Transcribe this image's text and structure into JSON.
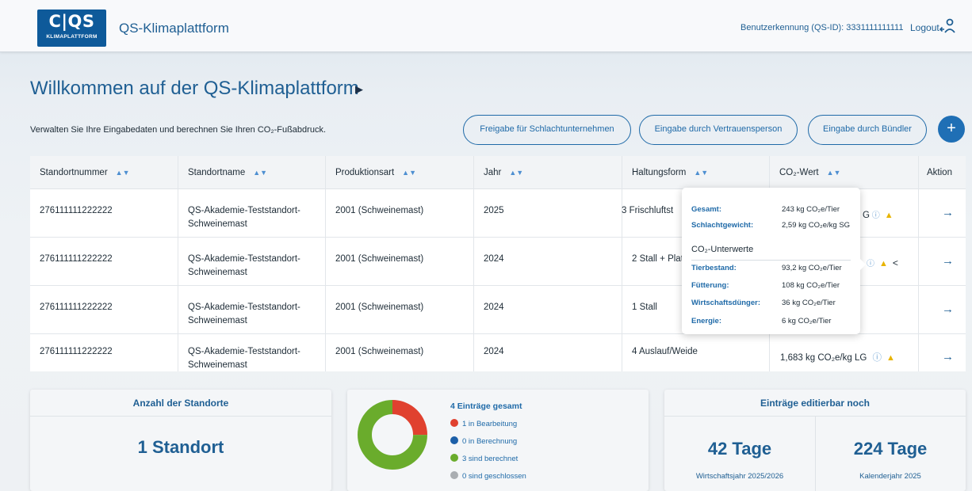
{
  "header": {
    "logo_mark": "C|QS",
    "logo_sub": "KLIMAPLATTFORM",
    "app_title": "QS-Klimaplattform",
    "user_id": "Benutzerkennung (QS-ID): 3331111111111",
    "logout": "Logout"
  },
  "page": {
    "title": "Willkommen auf der QS-Klimaplattform",
    "subline": "Verwalten Sie Ihre Eingabedaten und berechnen Sie Ihren CO₂-Fußabdruck.",
    "buttons": {
      "release": "Freigabe für Schlachtunternehmen",
      "trustee": "Eingabe durch Vertrauensperson",
      "bundler": "Eingabe durch Bündler"
    },
    "add_label": "+"
  },
  "table": {
    "headers": [
      "Standortnummer",
      "Standortname",
      "Produktionsart",
      "Jahr",
      "Haltungsform",
      "CO₂-Wert",
      "Aktion"
    ],
    "rows": [
      {
        "nr": "276111111222222",
        "name1": "QS-Akademie-Teststandort-",
        "name2": "Schweinemast",
        "art": "2001 (Schweinemast)",
        "jahr": "2025",
        "haltung": "3 Frischluftst",
        "co2": ""
      },
      {
        "nr": "276111111222222",
        "name1": "QS-Akademie-Teststandort-",
        "name2": "Schweinemast",
        "art": "2001 (Schweinemast)",
        "jahr": "2024",
        "haltung": "2 Stall + Platz",
        "co2": ""
      },
      {
        "nr": "276111111222222",
        "name1": "QS-Akademie-Teststandort-",
        "name2": "Schweinemast",
        "art": "2001 (Schweinemast)",
        "jahr": "2024",
        "haltung": "1 Stall",
        "co2": ""
      },
      {
        "nr": "276111111222222",
        "name1": "QS-Akademie-Teststandort-",
        "name2": "Schweinemast",
        "art": "2001 (Schweinemast)",
        "jahr": "2024",
        "haltung": "4 Auslauf/Weide",
        "co2": "1,683 kg CO₂e/kg LG"
      }
    ],
    "row1_co2_partial": "G",
    "icons": {
      "info": "info-icon",
      "warning": "warning-icon",
      "share": "share-icon",
      "arrow": "arrow-right-icon"
    }
  },
  "tooltip": {
    "gesamt_k": "Gesamt:",
    "gesamt_v": "243 kg CO₂e/Tier",
    "sg_k": "Schlachtgewicht:",
    "sg_v": "2,59 kg CO₂e/kg SG",
    "section": "CO₂-Unterwerte",
    "tier_k": "Tierbestand:",
    "tier_v": "93,2 kg CO₂e/Tier",
    "fut_k": "Fütterung:",
    "fut_v": "108 kg CO₂e/Tier",
    "wd_k": "Wirtschaftsdünger:",
    "wd_v": "36 kg CO₂e/Tier",
    "en_k": "Energie:",
    "en_v": "6 kg CO₂e/Tier"
  },
  "cards": {
    "sites_title": "Anzahl der Standorte",
    "sites_value": "1 Standort",
    "entries_title": "4 Einträge gesamt",
    "legend": [
      {
        "label": "1 in Bearbeitung",
        "color": "#e0412f",
        "count": 1
      },
      {
        "label": "0 in Berechnung",
        "color": "#1c5fa8",
        "count": 0
      },
      {
        "label": "3 sind berechnet",
        "color": "#6aac2c",
        "count": 3
      },
      {
        "label": "0 sind geschlossen",
        "color": "#a9adb1",
        "count": 0
      }
    ],
    "editable_title": "Einträge editierbar noch",
    "days_fy": "42 Tage",
    "fy_label": "Wirtschaftsjahr 2025/2026",
    "days_cy": "224 Tage",
    "cy_label": "Kalenderjahr 2025"
  },
  "colors": {
    "brand": "#0e5a9a",
    "accent": "#1f6aa8"
  }
}
